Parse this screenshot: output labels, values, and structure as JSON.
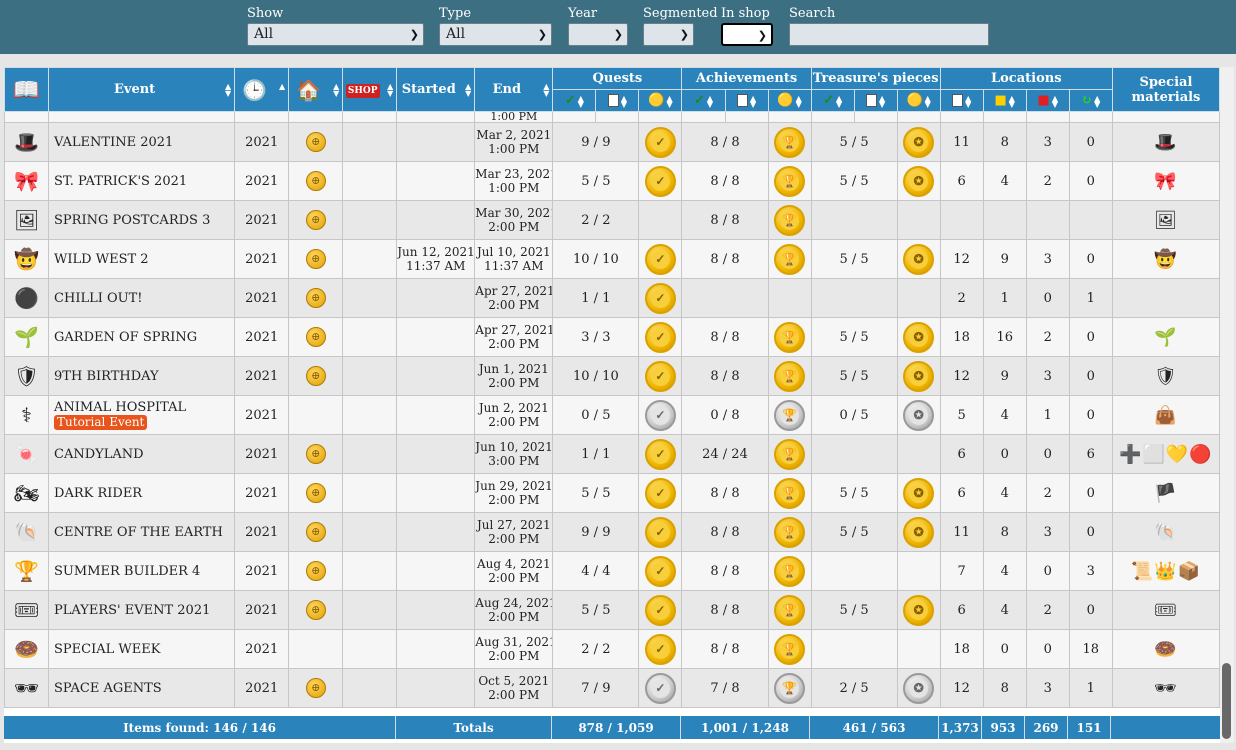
{
  "filters": {
    "show": {
      "label": "Show",
      "value": "All"
    },
    "type": {
      "label": "Type",
      "value": "All"
    },
    "year": {
      "label": "Year",
      "value": ""
    },
    "segmented": {
      "label": "Segmented",
      "value": ""
    },
    "in_shop": {
      "label": "In shop",
      "value": ""
    },
    "search": {
      "label": "Search",
      "value": ""
    }
  },
  "headers": {
    "event": "Event",
    "started": "Started",
    "end": "End",
    "quests": "Quests",
    "achievements": "Achievements",
    "treasure": "Treasure's pieces",
    "locations": "Locations",
    "special_line1": "Special",
    "special_line2": "materials"
  },
  "rows": [
    {
      "icon": "🎩",
      "event": "VALENTINE 2021",
      "year": "2021",
      "globe": true,
      "started": "",
      "started2": "",
      "end": "Mar 2, 2021",
      "end2": "1:00 PM",
      "quests": "9 / 9",
      "q_medal": "gold",
      "ach": "8 / 8",
      "a_medal": "gold",
      "tr": "5 / 5",
      "t_medal": "gold",
      "l1": "11",
      "l2": "8",
      "l3": "3",
      "l4": "0",
      "mats": "🎩"
    },
    {
      "icon": "🎀",
      "event": "ST. PATRICK'S 2021",
      "year": "2021",
      "globe": true,
      "started": "",
      "started2": "",
      "end": "Mar 23, 2021",
      "end2": "1:00 PM",
      "quests": "5 / 5",
      "q_medal": "gold",
      "ach": "8 / 8",
      "a_medal": "gold",
      "tr": "5 / 5",
      "t_medal": "gold",
      "l1": "6",
      "l2": "4",
      "l3": "2",
      "l4": "0",
      "mats": "🎀"
    },
    {
      "icon": "🖼",
      "event": "SPRING POSTCARDS 3",
      "year": "2021",
      "globe": true,
      "started": "",
      "started2": "",
      "end": "Mar 30, 2021",
      "end2": "2:00 PM",
      "quests": "2 / 2",
      "q_medal": "",
      "ach": "8 / 8",
      "a_medal": "gold",
      "tr": "",
      "t_medal": "",
      "l1": "",
      "l2": "",
      "l3": "",
      "l4": "",
      "mats": "🖼"
    },
    {
      "icon": "🤠",
      "event": "WILD WEST 2",
      "year": "2021",
      "globe": true,
      "started": "Jun 12, 2021",
      "started2": "11:37 AM",
      "end": "Jul 10, 2021",
      "end2": "11:37 AM",
      "quests": "10 / 10",
      "q_medal": "gold",
      "ach": "8 / 8",
      "a_medal": "gold",
      "tr": "5 / 5",
      "t_medal": "gold",
      "l1": "12",
      "l2": "9",
      "l3": "3",
      "l4": "0",
      "mats": "🤠"
    },
    {
      "icon": "⚫",
      "event": "CHILLI OUT!",
      "year": "2021",
      "globe": true,
      "started": "",
      "started2": "",
      "end": "Apr 27, 2021",
      "end2": "2:00 PM",
      "quests": "1 / 1",
      "q_medal": "gold",
      "ach": "",
      "a_medal": "",
      "tr": "",
      "t_medal": "",
      "l1": "2",
      "l2": "1",
      "l3": "0",
      "l4": "1",
      "mats": ""
    },
    {
      "icon": "🌱",
      "event": "GARDEN OF SPRING",
      "year": "2021",
      "globe": true,
      "started": "",
      "started2": "",
      "end": "Apr 27, 2021",
      "end2": "2:00 PM",
      "quests": "3 / 3",
      "q_medal": "gold",
      "ach": "8 / 8",
      "a_medal": "gold",
      "tr": "5 / 5",
      "t_medal": "gold",
      "l1": "18",
      "l2": "16",
      "l3": "2",
      "l4": "0",
      "mats": "🌱"
    },
    {
      "icon": "🛡",
      "event": "9TH BIRTHDAY",
      "year": "2021",
      "globe": true,
      "started": "",
      "started2": "",
      "end": "Jun 1, 2021",
      "end2": "2:00 PM",
      "quests": "10 / 10",
      "q_medal": "gold",
      "ach": "8 / 8",
      "a_medal": "gold",
      "tr": "5 / 5",
      "t_medal": "gold",
      "l1": "12",
      "l2": "9",
      "l3": "3",
      "l4": "0",
      "mats": "🛡"
    },
    {
      "icon": "⚕",
      "event": "ANIMAL HOSPITAL",
      "tag": "Tutorial Event",
      "year": "2021",
      "globe": false,
      "started": "",
      "started2": "",
      "end": "Jun 2, 2021",
      "end2": "2:00 PM",
      "quests": "0 / 5",
      "q_medal": "silver",
      "ach": "0 / 8",
      "a_medal": "silver",
      "tr": "0 / 5",
      "t_medal": "silver",
      "l1": "5",
      "l2": "4",
      "l3": "1",
      "l4": "0",
      "mats": "👜"
    },
    {
      "icon": "🍬",
      "event": "CANDYLAND",
      "year": "2021",
      "globe": true,
      "started": "",
      "started2": "",
      "end": "Jun 10, 2021",
      "end2": "3:00 PM",
      "quests": "1 / 1",
      "q_medal": "gold",
      "ach": "24 / 24",
      "a_medal": "gold",
      "tr": "",
      "t_medal": "",
      "l1": "6",
      "l2": "0",
      "l3": "0",
      "l4": "6",
      "mats": "➕⬜💛🔴"
    },
    {
      "icon": "🏍",
      "event": "DARK RIDER",
      "year": "2021",
      "globe": true,
      "started": "",
      "started2": "",
      "end": "Jun 29, 2021",
      "end2": "2:00 PM",
      "quests": "5 / 5",
      "q_medal": "gold",
      "ach": "8 / 8",
      "a_medal": "gold",
      "tr": "5 / 5",
      "t_medal": "gold",
      "l1": "6",
      "l2": "4",
      "l3": "2",
      "l4": "0",
      "mats": "🏴"
    },
    {
      "icon": "🐚",
      "event": "CENTRE OF THE EARTH",
      "year": "2021",
      "globe": true,
      "started": "",
      "started2": "",
      "end": "Jul 27, 2021",
      "end2": "2:00 PM",
      "quests": "9 / 9",
      "q_medal": "gold",
      "ach": "8 / 8",
      "a_medal": "gold",
      "tr": "5 / 5",
      "t_medal": "gold",
      "l1": "11",
      "l2": "8",
      "l3": "3",
      "l4": "0",
      "mats": "🐚"
    },
    {
      "icon": "🏆",
      "event": "SUMMER BUILDER 4",
      "year": "2021",
      "globe": true,
      "started": "",
      "started2": "",
      "end": "Aug 4, 2021",
      "end2": "2:00 PM",
      "quests": "4 / 4",
      "q_medal": "gold",
      "ach": "8 / 8",
      "a_medal": "gold",
      "tr": "",
      "t_medal": "",
      "l1": "7",
      "l2": "4",
      "l3": "0",
      "l4": "3",
      "mats": "📜👑📦"
    },
    {
      "icon": "🎟",
      "event": "PLAYERS' EVENT 2021",
      "year": "2021",
      "globe": true,
      "started": "",
      "started2": "",
      "end": "Aug 24, 2021",
      "end2": "2:00 PM",
      "quests": "5 / 5",
      "q_medal": "gold",
      "ach": "8 / 8",
      "a_medal": "gold",
      "tr": "5 / 5",
      "t_medal": "gold",
      "l1": "6",
      "l2": "4",
      "l3": "2",
      "l4": "0",
      "mats": "🎟"
    },
    {
      "icon": "🍩",
      "event": "SPECIAL WEEK",
      "year": "2021",
      "globe": false,
      "started": "",
      "started2": "",
      "end": "Aug 31, 2021",
      "end2": "2:00 PM",
      "quests": "2 / 2",
      "q_medal": "gold",
      "ach": "8 / 8",
      "a_medal": "gold",
      "tr": "",
      "t_medal": "",
      "l1": "18",
      "l2": "0",
      "l3": "0",
      "l4": "18",
      "mats": "🍩"
    },
    {
      "icon": "🕶",
      "event": "SPACE AGENTS",
      "year": "2021",
      "globe": true,
      "started": "",
      "started2": "",
      "end": "Oct 5, 2021",
      "end2": "2:00 PM",
      "quests": "7 / 9",
      "q_medal": "silver",
      "ach": "7 / 8",
      "a_medal": "silver",
      "tr": "2 / 5",
      "t_medal": "silver",
      "l1": "12",
      "l2": "8",
      "l3": "3",
      "l4": "1",
      "mats": "🕶"
    }
  ],
  "footer": {
    "items_found": "Items found: 146 / 146",
    "totals": "Totals",
    "quests": "878 / 1,059",
    "ach": "1,001 / 1,248",
    "tr": "461 / 563",
    "l1": "1,373",
    "l2": "953",
    "l3": "269",
    "l4": "151"
  },
  "partial_row": {
    "end2": "1:00 PM"
  },
  "colors": {
    "bar": "#3d6f82",
    "header": "#2a83ba",
    "gold": "#f0b400",
    "silver": "#c8c8c8",
    "tag": "#e8541c"
  },
  "icons": {
    "medal_check": "✓",
    "medal_trophy": "🏆",
    "medal_treasure": "✪",
    "globe": "🌐",
    "clock": "🕒",
    "shop": "SHOP",
    "house": "🏠",
    "book": "📖"
  }
}
